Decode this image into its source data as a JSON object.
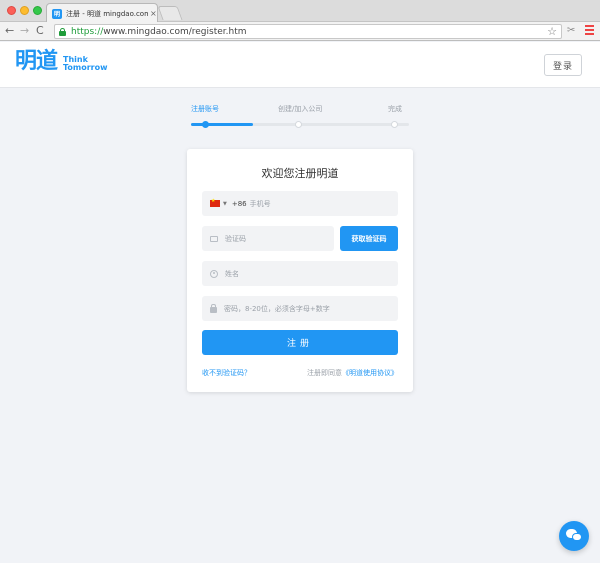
{
  "browser": {
    "tab_title": "注册 - 明道 mingdao.com",
    "tab_close": "×",
    "favicon": "明",
    "url_scheme": "https://",
    "url_rest": "www.mingdao.com/register.htm",
    "nav_back": "←",
    "nav_forward": "→",
    "nav_reload": "C",
    "star": "☆",
    "extension": "✂"
  },
  "header": {
    "logo_cn": "明道",
    "logo_tag_line1": "Think",
    "logo_tag_line2": "Tomorrow",
    "login_label": "登录"
  },
  "steps": [
    {
      "label": "注册账号",
      "active": true
    },
    {
      "label": "创建/加入公司",
      "active": false
    },
    {
      "label": "完成",
      "active": false
    }
  ],
  "form": {
    "title": "欢迎您注册明道",
    "country_code": "+86",
    "caret": "▼",
    "phone_placeholder": "手机号",
    "code_placeholder": "验证码",
    "get_code_label": "获取验证码",
    "name_placeholder": "姓名",
    "password_placeholder": "密码，8-20位，必须含字母+数字",
    "submit_label": "注册",
    "no_code_link": "收不到验证码？",
    "agree_prefix": "注册即同意",
    "agree_link": "《明道使用协议》"
  },
  "colors": {
    "accent": "#2196f3",
    "page_bg": "#f1f3f7"
  }
}
